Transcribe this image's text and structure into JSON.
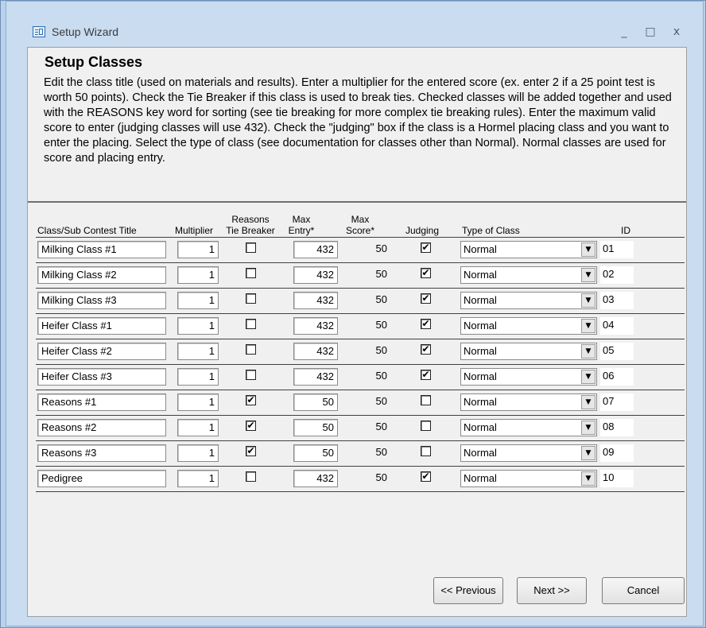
{
  "window": {
    "title": "Setup Wizard",
    "controls": {
      "minimize": "_",
      "maximize": "□",
      "close": "x"
    }
  },
  "page": {
    "heading": "Setup Classes",
    "instructions": "Edit the class title (used on materials and results).  Enter a multiplier for the entered score (ex. enter 2 if a 25 point test is worth 50 points).  Check the Tie Breaker if this class is used to break ties.  Checked classes will be added together and used with the REASONS key word for sorting (see tie breaking for more complex tie breaking rules).  Enter the maximum valid score to enter (judging classes will use 432).  Check the \"judging\" box if the class is a Hormel placing class and you want to enter the placing.  Select the type of class (see documentation for classes other than Normal).  Normal classes are used for score and placing entry."
  },
  "columns": {
    "title": "Class/Sub Contest Title",
    "multiplier": "Multiplier",
    "tie_breaker_1": "Reasons",
    "tie_breaker_2": "Tie Breaker",
    "max_entry_1": "Max",
    "max_entry_2": "Entry*",
    "max_score_1": "Max",
    "max_score_2": "Score*",
    "judging": "Judging",
    "type": "Type of Class",
    "id": "ID"
  },
  "rows": [
    {
      "title": "Milking Class #1",
      "multiplier": "1",
      "tie_breaker": false,
      "max_entry": "432",
      "max_score": "50",
      "judging": true,
      "type": "Normal",
      "id": "01"
    },
    {
      "title": "Milking Class #2",
      "multiplier": "1",
      "tie_breaker": false,
      "max_entry": "432",
      "max_score": "50",
      "judging": true,
      "type": "Normal",
      "id": "02"
    },
    {
      "title": "Milking Class #3",
      "multiplier": "1",
      "tie_breaker": false,
      "max_entry": "432",
      "max_score": "50",
      "judging": true,
      "type": "Normal",
      "id": "03"
    },
    {
      "title": "Heifer Class #1",
      "multiplier": "1",
      "tie_breaker": false,
      "max_entry": "432",
      "max_score": "50",
      "judging": true,
      "type": "Normal",
      "id": "04"
    },
    {
      "title": "Heifer Class #2",
      "multiplier": "1",
      "tie_breaker": false,
      "max_entry": "432",
      "max_score": "50",
      "judging": true,
      "type": "Normal",
      "id": "05"
    },
    {
      "title": "Heifer Class #3",
      "multiplier": "1",
      "tie_breaker": false,
      "max_entry": "432",
      "max_score": "50",
      "judging": true,
      "type": "Normal",
      "id": "06"
    },
    {
      "title": "Reasons #1",
      "multiplier": "1",
      "tie_breaker": true,
      "max_entry": "50",
      "max_score": "50",
      "judging": false,
      "type": "Normal",
      "id": "07"
    },
    {
      "title": "Reasons #2",
      "multiplier": "1",
      "tie_breaker": true,
      "max_entry": "50",
      "max_score": "50",
      "judging": false,
      "type": "Normal",
      "id": "08"
    },
    {
      "title": "Reasons #3",
      "multiplier": "1",
      "tie_breaker": true,
      "max_entry": "50",
      "max_score": "50",
      "judging": false,
      "type": "Normal",
      "id": "09"
    },
    {
      "title": "Pedigree",
      "multiplier": "1",
      "tie_breaker": false,
      "max_entry": "432",
      "max_score": "50",
      "judging": true,
      "type": "Normal",
      "id": "10"
    }
  ],
  "buttons": {
    "previous": "<< Previous",
    "next": "Next >>",
    "cancel": "Cancel"
  },
  "icons": {
    "app": "form-icon",
    "checkmark": "✔",
    "dropdown": "▼"
  }
}
